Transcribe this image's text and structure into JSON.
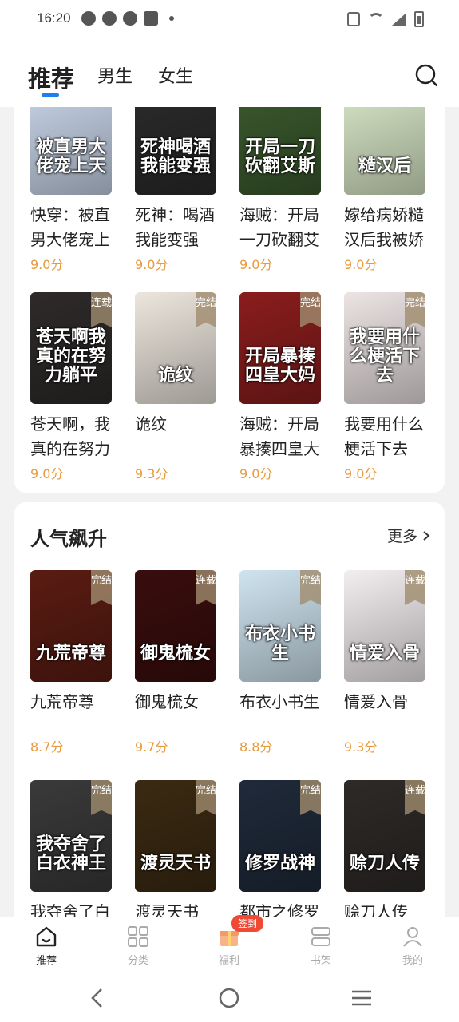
{
  "status": {
    "time": "16:20"
  },
  "tabs": [
    {
      "label": "推荐",
      "active": true
    },
    {
      "label": "男生",
      "active": false
    },
    {
      "label": "女生",
      "active": false
    }
  ],
  "colors": {
    "accent": "#1e7ef0",
    "score": "#e89a3c",
    "badge_red": "#f04a35"
  },
  "section1": {
    "books": [
      {
        "cover_text": "被直男大佬宠上天",
        "cover_color": "#c9d6ea",
        "name": "快穿：被直男大佬宠上",
        "score": "9.0分",
        "badge": ""
      },
      {
        "cover_text": "死神喝酒我能变强",
        "cover_color": "#2b2b2b",
        "name": "死神：喝酒我能变强",
        "score": "9.0分",
        "badge": ""
      },
      {
        "cover_text": "开局一刀砍翻艾斯",
        "cover_color": "#3b5a2e",
        "name": "海贼：开局一刀砍翻艾",
        "score": "9.0分",
        "badge": ""
      },
      {
        "cover_text": "糙汉后",
        "cover_color": "#d9e8c8",
        "name": "嫁给病娇糙汉后我被娇",
        "score": "9.0分",
        "badge": ""
      },
      {
        "cover_text": "苍天啊我真的在努力躺平",
        "cover_color": "#2e2a2a",
        "name": "苍天啊，我真的在努力",
        "score": "9.0分",
        "badge": "连载"
      },
      {
        "cover_text": "诡纹",
        "cover_color": "#ece6dd",
        "name": "诡纹",
        "score": "9.3分",
        "badge": "完结"
      },
      {
        "cover_text": "开局暴揍四皇大妈",
        "cover_color": "#8a1d1d",
        "name": "海贼：开局暴揍四皇大",
        "score": "9.0分",
        "badge": "完结"
      },
      {
        "cover_text": "我要用什么梗活下去",
        "cover_color": "#ede4e4",
        "name": "我要用什么梗活下去",
        "score": "9.0分",
        "badge": "完结"
      }
    ]
  },
  "section2": {
    "title": "人气飙升",
    "more": "更多",
    "books": [
      {
        "cover_text": "九荒帝尊",
        "cover_color": "#5a1c12",
        "name": "九荒帝尊",
        "score": "8.7分",
        "badge": "完结"
      },
      {
        "cover_text": "御鬼梳女",
        "cover_color": "#3a0d0d",
        "name": "御鬼梳女",
        "score": "9.7分",
        "badge": "连载"
      },
      {
        "cover_text": "布衣小书生",
        "cover_color": "#cfe4f0",
        "name": "布衣小书生",
        "score": "8.8分",
        "badge": "完结"
      },
      {
        "cover_text": "情爱入骨",
        "cover_color": "#f3eef0",
        "name": "情爱入骨",
        "score": "9.3分",
        "badge": "连载"
      },
      {
        "cover_text": "我夺舍了白衣神王",
        "cover_color": "#3a3a3a",
        "name": "我夺舍了白",
        "score": "",
        "badge": "完结"
      },
      {
        "cover_text": "渡灵天书",
        "cover_color": "#3b2a12",
        "name": "渡灵天书",
        "score": "",
        "badge": "完结"
      },
      {
        "cover_text": "修罗战神",
        "cover_color": "#1f2a3a",
        "name": "都市之修罗",
        "score": "",
        "badge": "完结"
      },
      {
        "cover_text": "赊刀人传",
        "cover_color": "#2e2a28",
        "name": "赊刀人传",
        "score": "",
        "badge": "连载"
      }
    ]
  },
  "bottom_nav": [
    {
      "label": "推荐",
      "icon": "home-icon",
      "active": true
    },
    {
      "label": "分类",
      "icon": "grid-icon",
      "active": false
    },
    {
      "label": "福利",
      "icon": "gift-icon",
      "active": false,
      "badge": "签到"
    },
    {
      "label": "书架",
      "icon": "bookshelf-icon",
      "active": false
    },
    {
      "label": "我的",
      "icon": "profile-icon",
      "active": false
    }
  ]
}
